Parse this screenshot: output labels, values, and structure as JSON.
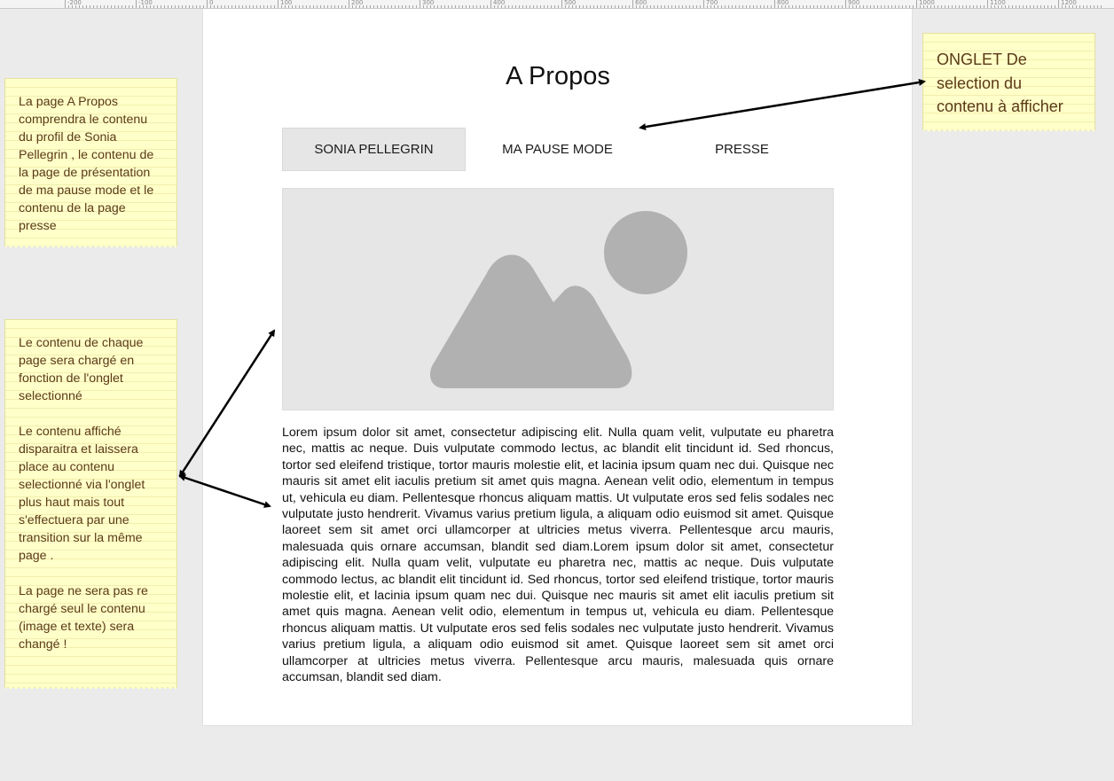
{
  "ruler": {
    "labels": [
      "-200",
      "-100",
      "0",
      "100",
      "200",
      "300",
      "400",
      "500",
      "600",
      "700",
      "800",
      "900",
      "1000",
      "1100",
      "1200"
    ]
  },
  "page": {
    "title": "A Propos",
    "tabs": [
      {
        "label": "SONIA PELLEGRIN",
        "active": true
      },
      {
        "label": "MA PAUSE MODE",
        "active": false
      },
      {
        "label": "PRESSE",
        "active": false
      }
    ],
    "image_placeholder": "image-icon",
    "body": "Lorem ipsum dolor sit amet, consectetur adipiscing elit. Nulla quam velit, vulputate eu pharetra nec, mattis ac neque. Duis vulputate commodo lectus, ac blandit elit tincidunt id. Sed rhoncus, tortor sed eleifend tristique, tortor mauris molestie elit, et lacinia ipsum quam nec dui. Quisque nec mauris sit amet elit iaculis pretium sit amet quis magna. Aenean velit odio, elementum in tempus ut, vehicula eu diam. Pellentesque rhoncus aliquam mattis. Ut vulputate eros sed felis sodales nec vulputate justo hendrerit. Vivamus varius pretium ligula, a aliquam odio euismod sit amet. Quisque laoreet sem sit amet orci ullamcorper at ultricies metus viverra. Pellentesque arcu mauris, malesuada quis ornare accumsan, blandit sed diam.Lorem ipsum dolor sit amet, consectetur adipiscing elit. Nulla quam velit, vulputate eu pharetra nec, mattis ac neque. Duis vulputate commodo lectus, ac blandit elit tincidunt id. Sed rhoncus, tortor sed eleifend tristique, tortor mauris molestie elit, et lacinia ipsum quam nec dui. Quisque nec mauris sit amet elit iaculis pretium sit amet quis magna. Aenean velit odio, elementum in tempus ut, vehicula eu diam. Pellentesque rhoncus aliquam mattis. Ut vulputate eros sed felis sodales nec vulputate justo hendrerit. Vivamus varius pretium ligula, a aliquam odio euismod sit amet. Quisque laoreet sem sit amet orci ullamcorper at ultricies metus viverra. Pellentesque arcu mauris, malesuada quis ornare accumsan, blandit sed diam."
  },
  "notes": {
    "about": "La page A Propos\ncomprendra le contenu\ndu profil de Sonia\nPellegrin , le contenu de\nla page de présentation\nde ma pause mode et le\ncontenu de la page\npresse",
    "content": "Le contenu de chaque\npage sera chargé en\nfonction de l'onglet\nselectionné\n\nLe contenu affiché\ndisparaitra et laissera\nplace au contenu\nselectionné via l'onglet\nplus  haut mais tout\ns'effectuera par une\ntransition sur la même\npage .\n\nLa page ne sera pas re\nchargé seul le contenu\n(image et texte) sera\nchangé !",
    "tabs": "ONGLET De\nselection du\ncontenu à afficher"
  },
  "colors": {
    "note_bg": "#ffffc9",
    "note_text": "#5b3a16",
    "tab_active_bg": "#e6e6e6",
    "image_shape": "#b1b1b1",
    "canvas_bg": "#ebebeb"
  }
}
